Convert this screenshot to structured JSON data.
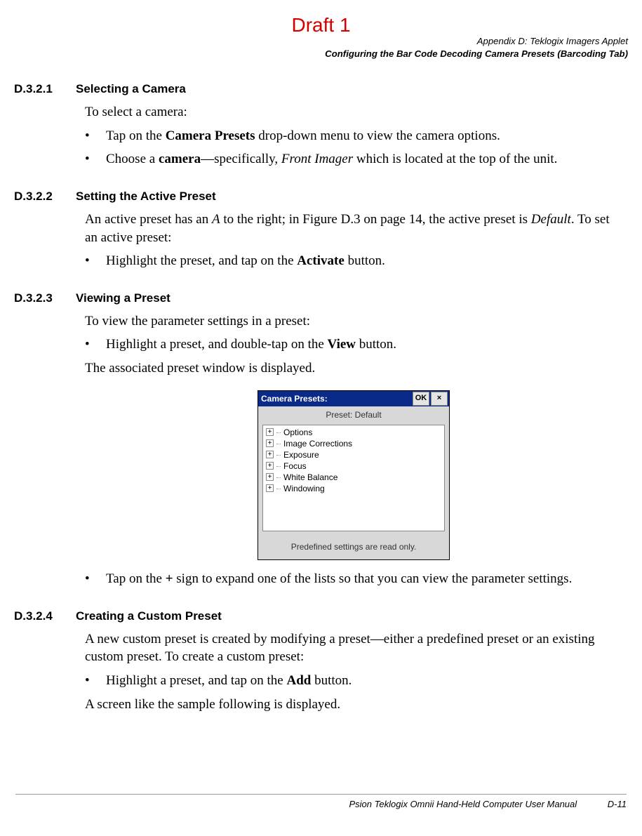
{
  "draft": "Draft 1",
  "header": {
    "line1": "Appendix D: Teklogix Imagers Applet",
    "line2": "Configuring the Bar Code Decoding Camera Presets (Barcoding Tab)"
  },
  "s1": {
    "num": "D.3.2.1",
    "title": "Selecting a Camera",
    "intro": "To select a camera:",
    "b1_pre": "Tap on the ",
    "b1_bold": "Camera Presets",
    "b1_post": " drop-down menu to view the camera options.",
    "b2_pre": "Choose a ",
    "b2_bold": "camera",
    "b2_mid": "—specifically, ",
    "b2_ital": "Front Imager",
    "b2_post": " which is located at the top of the unit."
  },
  "s2": {
    "num": "D.3.2.2",
    "title": "Setting the Active Preset",
    "p_pre": "An active preset has an ",
    "p_ital1": "A",
    "p_mid": " to the right; in Figure D.3 on page 14, the active preset is ",
    "p_ital2": "Default",
    "p_post": ". To set an active preset:",
    "b1_pre": "Highlight the preset, and tap on the ",
    "b1_bold": "Activate",
    "b1_post": " button."
  },
  "s3": {
    "num": "D.3.2.3",
    "title": "Viewing a Preset",
    "intro": "To view the parameter settings in a preset:",
    "b1_pre": "Highlight a preset, and double-tap on the ",
    "b1_bold": "View",
    "b1_post": " button.",
    "after": "The associated preset window is displayed.",
    "b2_pre": "Tap on the ",
    "b2_bold": "+",
    "b2_post": " sign to expand one of the lists so that you can view the parameter settings."
  },
  "win": {
    "title": "Camera Presets:",
    "ok": "OK",
    "close": "×",
    "preset_label": "Preset: Default",
    "items": [
      "Options",
      "Image Corrections",
      "Exposure",
      "Focus",
      "White Balance",
      "Windowing"
    ],
    "status": "Predefined settings are read only."
  },
  "s4": {
    "num": "D.3.2.4",
    "title": "Creating a Custom Preset",
    "p": "A new custom preset is created by modifying a preset—either a predefined preset or an existing custom preset. To create a custom preset:",
    "b1_pre": "Highlight a preset, and tap on the ",
    "b1_bold": "Add",
    "b1_post": " button.",
    "after": "A screen like the sample following is displayed."
  },
  "footer": {
    "text": "Psion Teklogix Omnii Hand-Held Computer User Manual",
    "page": "D-11"
  }
}
